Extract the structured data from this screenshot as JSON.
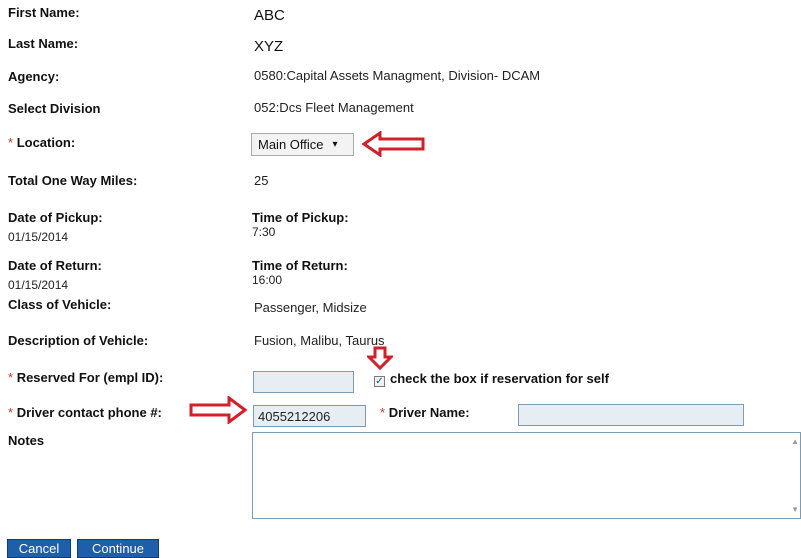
{
  "form": {
    "first_name": {
      "label": "First Name:",
      "value": "ABC"
    },
    "last_name": {
      "label": "Last Name:",
      "value": "XYZ"
    },
    "agency": {
      "label": "Agency:",
      "value": "0580:Capital Assets Managment, Division- DCAM"
    },
    "division": {
      "label": "Select Division",
      "value": "052:Dcs Fleet Management"
    },
    "location": {
      "required_mark": "*",
      "label": "Location:",
      "value": "Main Office",
      "caret": "▾"
    },
    "miles": {
      "label": "Total One Way Miles:",
      "value": "25"
    },
    "pickup_date": {
      "label": "Date of Pickup:",
      "value": "01/15/2014"
    },
    "pickup_time": {
      "label": "Time of Pickup:",
      "value": "7:30"
    },
    "return_date": {
      "label": "Date of Return:",
      "value": "01/15/2014"
    },
    "return_time": {
      "label": "Time of Return:",
      "value": "16:00"
    },
    "vehicle_class": {
      "label": "Class of Vehicle:",
      "value": "Passenger, Midsize"
    },
    "vehicle_desc": {
      "label": "Description of Vehicle:",
      "value": "Fusion, Malibu, Taurus"
    },
    "reserved_for": {
      "required_mark": "*",
      "label": "Reserved For (empl ID):",
      "value": ""
    },
    "self_checkbox": {
      "checked": true,
      "check_glyph": "✓",
      "label": "check the box if reservation for self"
    },
    "driver_phone": {
      "required_mark": "*",
      "label": "Driver contact phone #:",
      "value": "4055212206"
    },
    "driver_name": {
      "required_mark": "*",
      "label": "Driver Name:",
      "value": ""
    },
    "notes": {
      "label": "Notes",
      "value": ""
    }
  },
  "buttons": {
    "cancel": "Cancel",
    "continue": "Continue"
  },
  "annotations": {
    "color": "#d0202a"
  }
}
